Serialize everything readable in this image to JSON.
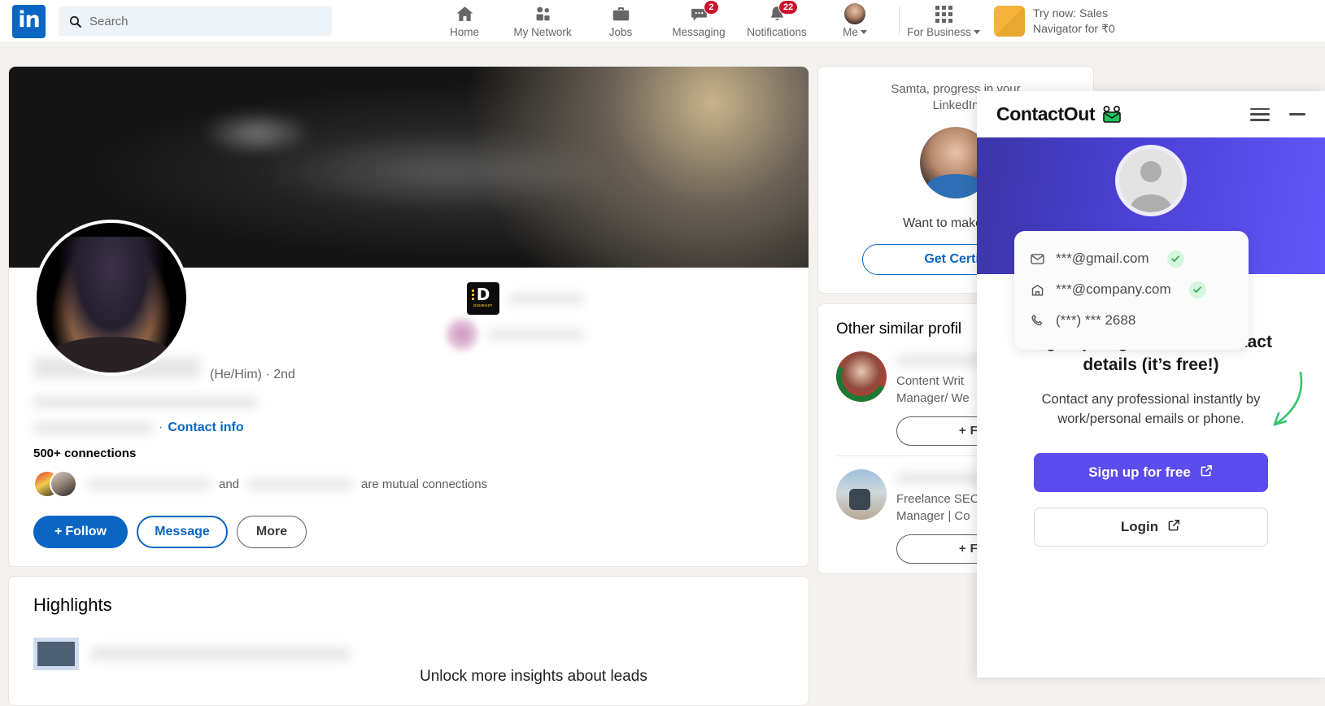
{
  "nav": {
    "logo": "in",
    "search_placeholder": "Search",
    "items": [
      {
        "label": "Home",
        "icon": "home-icon",
        "badge": ""
      },
      {
        "label": "My Network",
        "icon": "people-icon",
        "badge": ""
      },
      {
        "label": "Jobs",
        "icon": "briefcase-icon",
        "badge": ""
      },
      {
        "label": "Messaging",
        "icon": "message-icon",
        "badge": "2"
      },
      {
        "label": "Notifications",
        "icon": "bell-icon",
        "badge": "22"
      },
      {
        "label": "Me",
        "icon": "avatar-icon",
        "badge": ""
      }
    ],
    "for_business": "For Business",
    "promo_line1": "Try now: Sales",
    "promo_line2": "Navigator for ₹0"
  },
  "profile": {
    "pronoun": "(He/Him)",
    "degree": "2nd",
    "separator": "·",
    "contact_info": "Contact info",
    "connections": "500+ connections",
    "mutual_and": "and",
    "mutual_tail": "are mutual connections",
    "buttons": {
      "follow": "Follow",
      "follow_plus": "+",
      "message": "Message",
      "more": "More"
    },
    "company_logo_d": "D",
    "company_logo_wordmark": "DIGIEAZY"
  },
  "highlights": {
    "title": "Highlights",
    "unlock": "Unlock more insights about leads"
  },
  "right": {
    "progress_line1": "Samta, progress in your",
    "progress_line2": "LinkedIn",
    "want_text": "Want to make a gr",
    "get_certified": "Get Certifi",
    "similar_title": "Other similar profil",
    "similar": [
      {
        "role_line1": "Content Writ",
        "role_line2": "Manager/ We",
        "follow": "Follow",
        "follow_plus": "+"
      },
      {
        "role_line1": "Freelance SEO",
        "role_line2": "Manager | Co",
        "follow": "Follow",
        "follow_plus": "+"
      }
    ]
  },
  "contactout": {
    "brand": "ContactOut",
    "contacts": [
      {
        "icon": "envelope-icon",
        "value": "***@gmail.com",
        "verified": true
      },
      {
        "icon": "building-icon",
        "value": "***@company.com",
        "verified": true
      },
      {
        "icon": "phone-icon",
        "value": "(***) *** 2688",
        "verified": false
      }
    ],
    "heading": "Sign up to get sahib’s contact details (it’s free!)",
    "subtext": "Contact any professional instantly by work/personal emails or phone.",
    "signup_button": "Sign up for free",
    "login_button": "Login",
    "accent_color": "#5d4ced",
    "hero_gradient_from": "#3b35a6",
    "hero_gradient_to": "#6257f7",
    "verified_color": "#2faa52"
  }
}
